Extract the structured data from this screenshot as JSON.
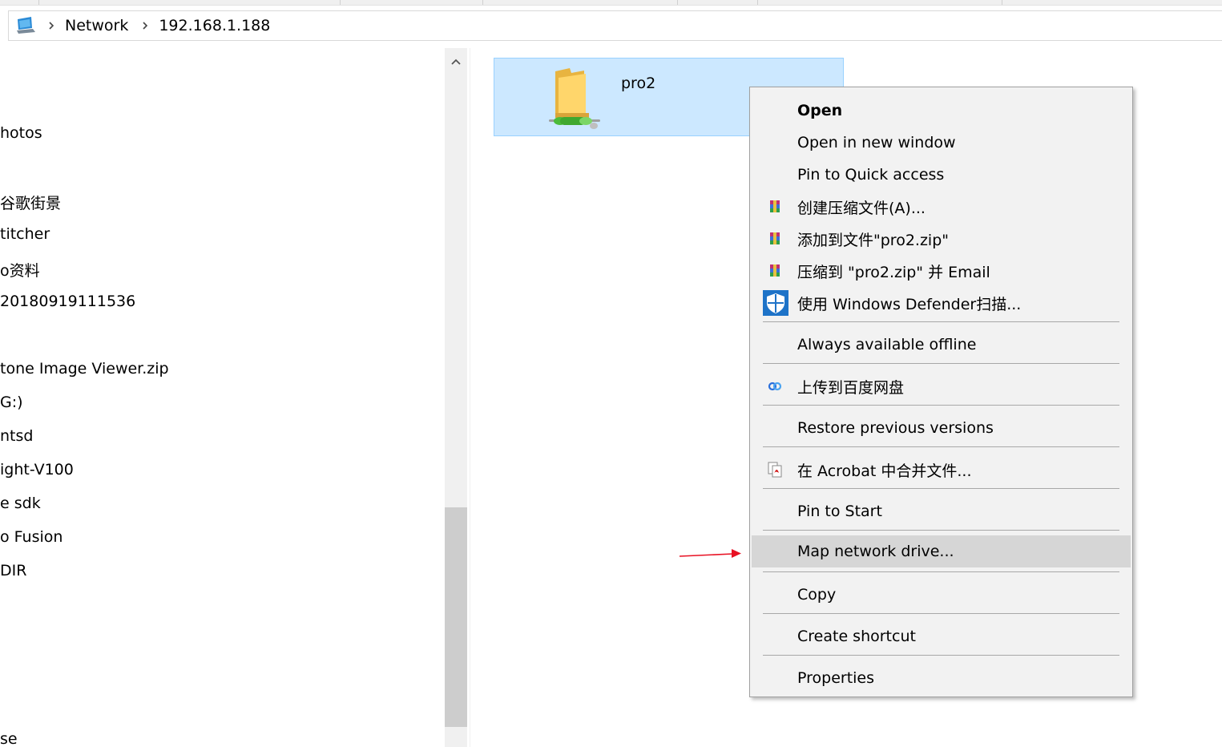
{
  "breadcrumb": {
    "items": [
      "Network",
      "192.168.1.188"
    ]
  },
  "nav_pane": {
    "items": [
      "hotos",
      "谷歌街景",
      "titcher",
      "o资料",
      "20180919111536",
      "tone Image Viewer.zip",
      "G:)",
      "ntsd",
      "ight-V100",
      "e sdk",
      "o Fusion",
      "DIR",
      "se"
    ]
  },
  "folder": {
    "name": "pro2",
    "icon": "network-folder-icon"
  },
  "context_menu": {
    "items": [
      {
        "label": "Open"
      },
      {
        "label": "Open in new window"
      },
      {
        "label": "Pin to Quick access"
      },
      {
        "label": "创建压缩文件(A)...",
        "icon": "winrar-icon"
      },
      {
        "label": "添加到文件\"pro2.zip\"",
        "icon": "winrar-icon"
      },
      {
        "label": "压缩到 \"pro2.zip\" 并 Email",
        "icon": "winrar-icon"
      },
      {
        "label": "使用 Windows Defender扫描...",
        "icon": "defender-shield-icon"
      },
      {
        "label": "Always available offline"
      },
      {
        "label": "上传到百度网盘",
        "icon": "baidu-netdisk-icon"
      },
      {
        "label": "Restore previous versions"
      },
      {
        "label": "在 Acrobat 中合并文件...",
        "icon": "acrobat-icon"
      },
      {
        "label": "Pin to Start"
      },
      {
        "label": "Map network drive..."
      },
      {
        "label": "Copy"
      },
      {
        "label": "Create shortcut"
      },
      {
        "label": "Properties"
      }
    ],
    "highlighted": "Map network drive..."
  },
  "colors": {
    "selection": "#cce8ff",
    "menu_bg": "#f2f2f2",
    "menu_highlight": "#d6d6d6",
    "annotation_arrow": "#e81123"
  }
}
